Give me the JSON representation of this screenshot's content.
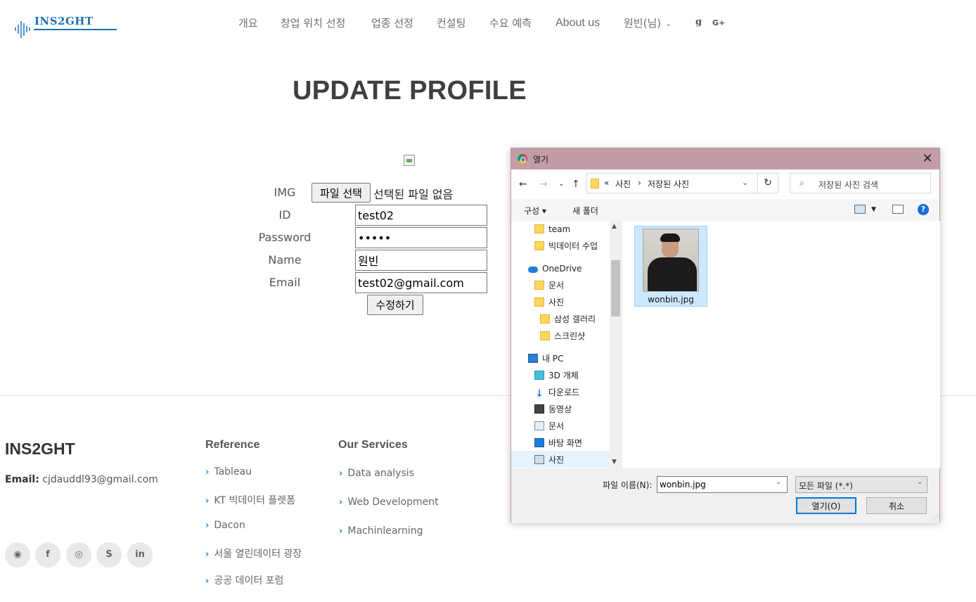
{
  "nav": {
    "logo_text": "INS2GHT",
    "items": [
      {
        "label": "개요"
      },
      {
        "label": "창업 위치 선정"
      },
      {
        "label": "업종 선정"
      },
      {
        "label": "컨설팅"
      },
      {
        "label": "수요 예측"
      },
      {
        "label": "About us"
      },
      {
        "label": "원빈(님)"
      }
    ],
    "icons": [
      "glyph-g-icon",
      "google-plus-icon"
    ],
    "google_plus_text": "G+",
    "glyph_text": "g"
  },
  "profile": {
    "title": "UPDATE PROFILE",
    "labels": {
      "img": "IMG",
      "id": "ID",
      "password": "Password",
      "name": "Name",
      "email": "Email"
    },
    "file_button": "파일 선택",
    "file_status": "선택된 파일 없음",
    "id_value": "test02",
    "password_value": "•••••",
    "name_value": "원빈",
    "email_value": "test02@gmail.com",
    "submit": "수정하기"
  },
  "footer": {
    "brand": "INS2GHT",
    "email_label": "Email:",
    "email_value": "cjdauddl93@gmail.com",
    "reference_title": "Reference",
    "reference_links": [
      "Tableau",
      "KT 빅데이터 플렛폼",
      "Dacon",
      "서울 열린데이터 광장",
      "공공 데이터 포럼"
    ],
    "services_title": "Our Services",
    "services_links": [
      "Data analysis",
      "Web Development",
      "Machinlearning"
    ],
    "social": [
      "github-icon",
      "facebook-icon",
      "instagram-icon",
      "skype-icon",
      "linkedin-icon"
    ],
    "social_glyphs": [
      "◉",
      "f",
      "◎",
      "S",
      "in"
    ]
  },
  "dialog": {
    "title": "열기",
    "close": "✕",
    "path": [
      "«",
      "사진",
      "›",
      "저장된 사진"
    ],
    "search_placeholder": "저장된 사진 검색",
    "toolbar": {
      "organize": "구성 ▾",
      "new_folder": "새 폴더"
    },
    "tree": [
      {
        "label": "team",
        "icon": "folder-icon"
      },
      {
        "label": "빅데이터 수업",
        "icon": "folder-icon"
      },
      {
        "label": "OneDrive",
        "icon": "onedrive-icon"
      },
      {
        "label": "문서",
        "icon": "folder-icon"
      },
      {
        "label": "사진",
        "icon": "folder-icon"
      },
      {
        "label": "삼성 갤러리",
        "icon": "folder-icon"
      },
      {
        "label": "스크린샷",
        "icon": "folder-icon"
      },
      {
        "label": "내 PC",
        "icon": "pc-icon"
      },
      {
        "label": "3D 개체",
        "icon": "3d-objects-icon"
      },
      {
        "label": "다운로드",
        "icon": "download-icon"
      },
      {
        "label": "동영상",
        "icon": "video-icon"
      },
      {
        "label": "문서",
        "icon": "documents-icon"
      },
      {
        "label": "바탕 화면",
        "icon": "desktop-icon"
      },
      {
        "label": "사진",
        "icon": "pictures-icon"
      }
    ],
    "file": {
      "name": "wonbin.jpg"
    },
    "filename_label": "파일 이름(N):",
    "filename_value": "wonbin.jpg",
    "filetype": "모든 파일 (*.*)",
    "open_button": "열기(O)",
    "cancel_button": "취소"
  }
}
